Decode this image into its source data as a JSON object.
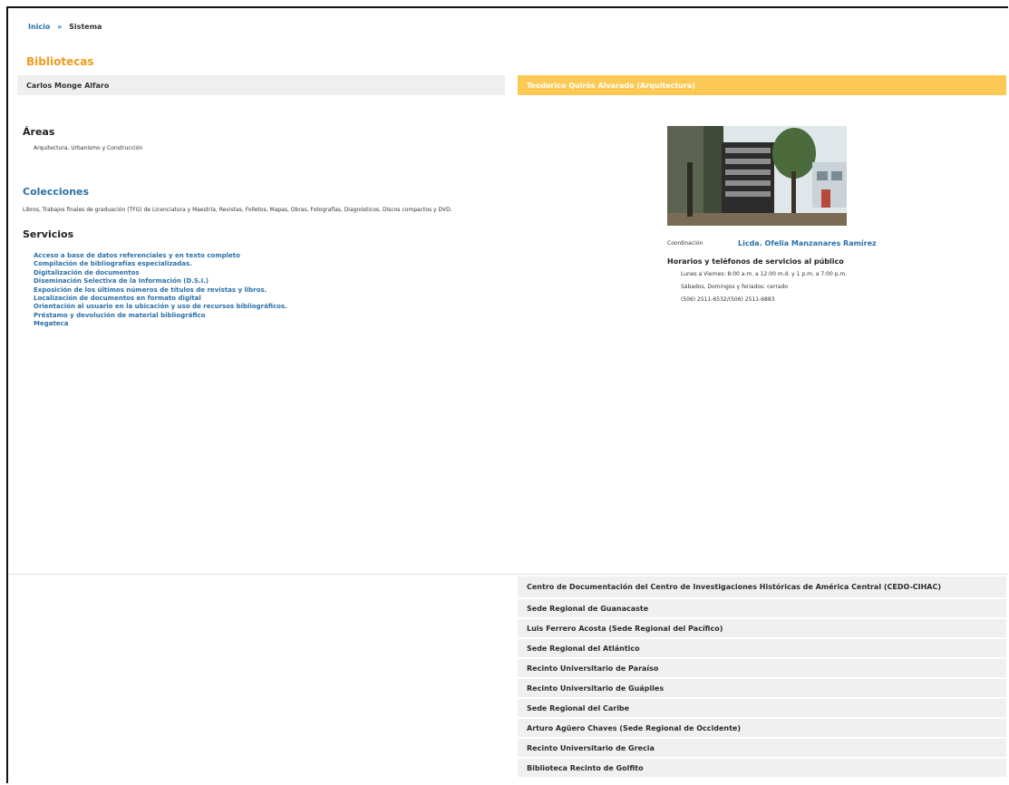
{
  "breadcrumb": {
    "home": "Inicio",
    "separator": "»",
    "current": "Sistema"
  },
  "page_title": "Bibliotecas",
  "tabs": {
    "left": "Carlos Monge Alfaro",
    "right": "Teodorico Quirós Alvarado (Arquitectura)"
  },
  "areas": {
    "heading": "Áreas",
    "text": "Arquitectura, Urbanismo y Construcción"
  },
  "colecciones": {
    "heading": "Colecciones",
    "text": "Libros, Trabajos finales de graduación (TFG) de Licenciatura y Maestría, Revistas, Folletos, Mapas, Obras, Fotografías, Diagnósticos, Discos compactos y DVD."
  },
  "servicios": {
    "heading": "Servicios",
    "items": [
      "Acceso a base de datos referenciales y en texto completo",
      "Compilación de bibliografías especializadas.",
      "Digitalización de documentos",
      "Diseminación Selectiva de la Información (D.S.I.)",
      "Exposición de los últimos números de títulos de revistas y libros.",
      "Localización de documentos en formato digital",
      "Orientación al usuario en la ubicación y uso de recursos bibliográficos.",
      "Préstamo y devolución de material bibliográfico",
      "Megateca"
    ]
  },
  "coordinacion": {
    "label": "Coordinación",
    "name": "Licda. Ofelia Manzanares Ramírez"
  },
  "horarios": {
    "heading": "Horarios y teléfonos de servicios al público",
    "lines": [
      "Lunes a Viernes: 8:00 a.m. a 12:00 m.d. y 1 p.m. a 7:00 p.m.",
      "Sábados, Domingos y feriados: cerrado",
      "(506) 2511-6532/(506) 2511-6883"
    ]
  },
  "photo": {
    "icon": "building-photo",
    "colors": {
      "sky": "#dfe7ea",
      "tree": "#3f4a37",
      "building": "#2c2c2c",
      "ground": "#7b6b55"
    }
  },
  "accordion": [
    "Centro de Documentación del Centro de Investigaciones Históricas de América Central (CEDO-CIHAC)",
    "Sede Regional de Guanacaste",
    "Luis Ferrero Acosta (Sede Regional del Pacífico)",
    "Sede Regional del Atlántico",
    "Recinto Universitario de Paraíso",
    "Recinto Universitario de Guápiles",
    "Sede Regional del Caribe",
    "Arturo Agüero Chaves (Sede Regional de Occidente)",
    "Recinto Universitario de Grecia",
    "Biblioteca Recinto de Golfito"
  ],
  "colors": {
    "accent_orange": "#f39a1e",
    "tab_active": "#fcc955",
    "link_blue": "#2a6fa8"
  }
}
